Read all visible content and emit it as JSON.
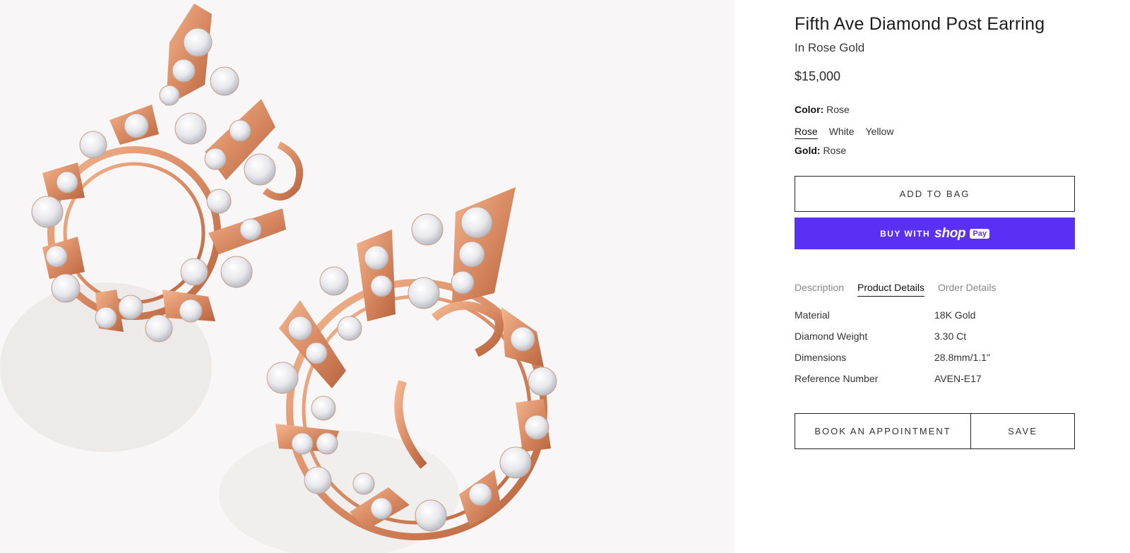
{
  "product": {
    "title": "Fifth Ave Diamond Post Earring",
    "subtitle": "In Rose Gold",
    "price": "$15,000"
  },
  "options": {
    "color_label": "Color:",
    "color_value": "Rose",
    "swatches": [
      "Rose",
      "White",
      "Yellow"
    ],
    "selected_swatch": "Rose",
    "gold_label": "Gold:",
    "gold_value": "Rose"
  },
  "actions": {
    "add_to_bag": "ADD TO BAG",
    "shop_pay_prefix": "BUY WITH",
    "shop_pay_brand": "shop",
    "shop_pay_badge": "Pay",
    "book_appointment": "BOOK AN APPOINTMENT",
    "save": "SAVE"
  },
  "tabs": [
    {
      "label": "Description",
      "active": false
    },
    {
      "label": "Product Details",
      "active": true
    },
    {
      "label": "Order Details",
      "active": false
    }
  ],
  "details": [
    {
      "key": "Material",
      "value": "18K Gold"
    },
    {
      "key": "Diamond Weight",
      "value": "3.30 Ct"
    },
    {
      "key": "Dimensions",
      "value": "28.8mm/1.1\""
    },
    {
      "key": "Reference Number",
      "value": "AVEN-E17"
    }
  ],
  "colors": {
    "shop_pay": "#5a31f4",
    "rose_gold": "#d98b63",
    "image_bg": "#f8f6f6"
  }
}
